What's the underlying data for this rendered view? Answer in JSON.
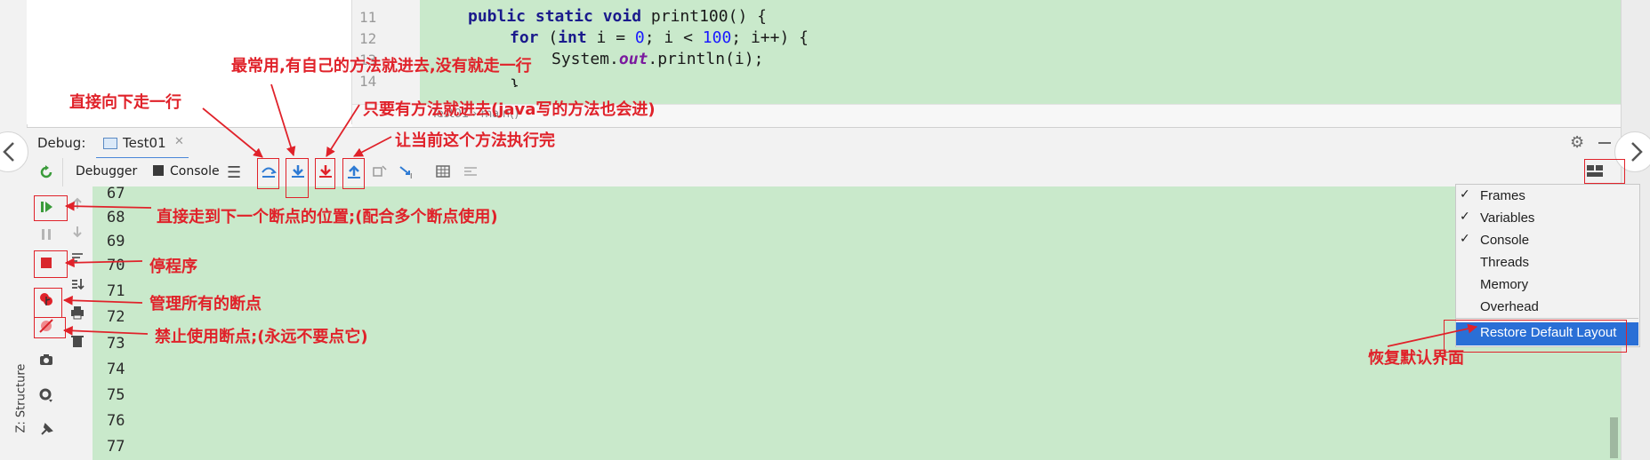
{
  "editor": {
    "line_numbers": [
      "11",
      "12",
      "13",
      "14"
    ],
    "breadcrumb": [
      "Test01",
      "main()"
    ]
  },
  "debug": {
    "title": "Debug:",
    "tab_label": "Test01",
    "tabs": [
      "Debugger",
      "Console"
    ]
  },
  "console": {
    "lines": [
      "67",
      "68",
      "69",
      "70",
      "71",
      "72",
      "73",
      "74",
      "75",
      "76",
      "77"
    ]
  },
  "side_panel": {
    "structure_label": "Z: Structure"
  },
  "layout_menu": {
    "items": [
      {
        "label": "Frames",
        "checked": true
      },
      {
        "label": "Variables",
        "checked": true
      },
      {
        "label": "Console",
        "checked": true
      },
      {
        "label": "Threads",
        "checked": false
      },
      {
        "label": "Memory",
        "checked": false
      },
      {
        "label": "Overhead",
        "checked": false
      }
    ],
    "restore_label": "Restore Default Layout"
  },
  "annotations": {
    "step_over": "直接向下走一行",
    "step_into": "最常用,有自己的方法就进去,没有就走一行",
    "force_step_into": "只要有方法就进去(java写的方法也会进)",
    "step_out": "让当前这个方法执行完",
    "resume": "直接走到下一个断点的位置;(配合多个断点使用)",
    "stop": "停程序",
    "view_breakpoints": "管理所有的断点",
    "mute_breakpoints": "禁止使用断点;(永远不要点它)",
    "restore_layout": "恢复默认界面"
  },
  "colors": {
    "annotation": "#e0222a",
    "editor_bg": "#c9e9cb",
    "selection": "#2a6fd6"
  }
}
